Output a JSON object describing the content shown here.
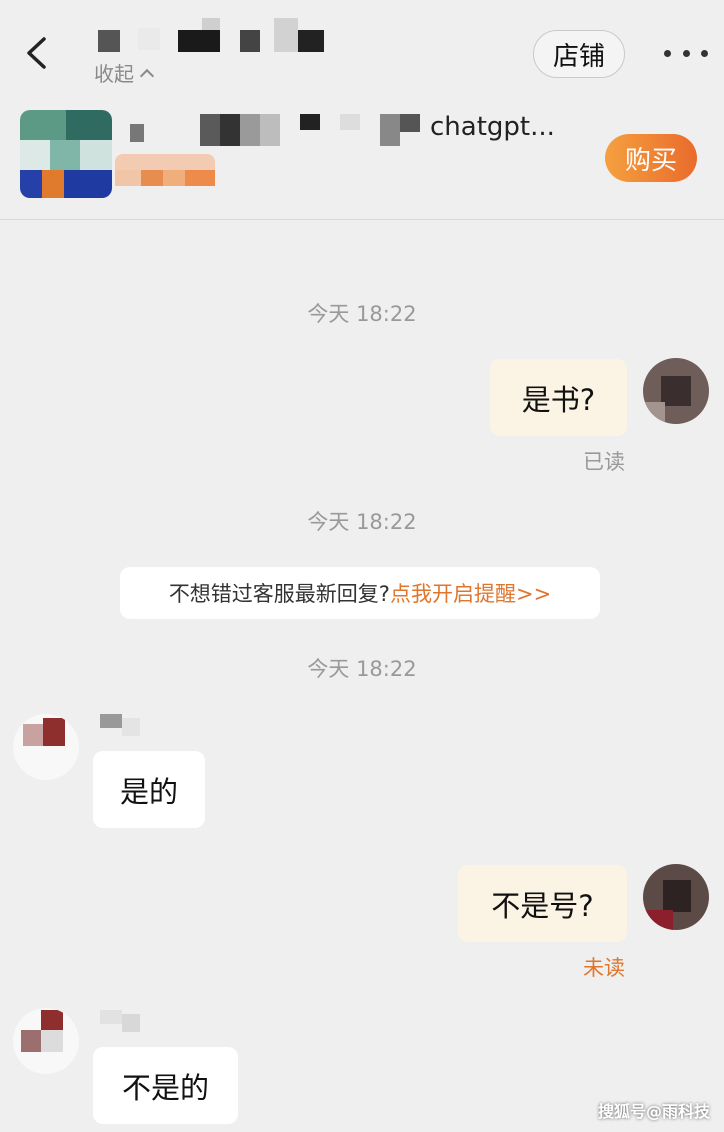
{
  "header": {
    "collapse_label": "收起",
    "store_label": "店铺",
    "buy_label": "购买",
    "product_name_suffix": "chatgpt..."
  },
  "chat": {
    "timestamps": [
      "今天 18:22",
      "今天 18:22",
      "今天 18:22"
    ],
    "notify": {
      "text": "不想错过客服最新回复?",
      "link": "点我开启提醒>>"
    },
    "messages": [
      {
        "from": "me",
        "text": "是书?",
        "status": "已读"
      },
      {
        "from": "them",
        "text": "是的"
      },
      {
        "from": "me",
        "text": "不是号?",
        "status": "未读"
      },
      {
        "from": "them",
        "text": "不是的"
      }
    ]
  },
  "colors": {
    "accent": "#e0762e",
    "buy_gradient_start": "#f5a040",
    "buy_gradient_end": "#e96b2b",
    "my_bubble": "#fbf4e4",
    "their_bubble": "#ffffff"
  },
  "watermark": "搜狐号@雨科技"
}
